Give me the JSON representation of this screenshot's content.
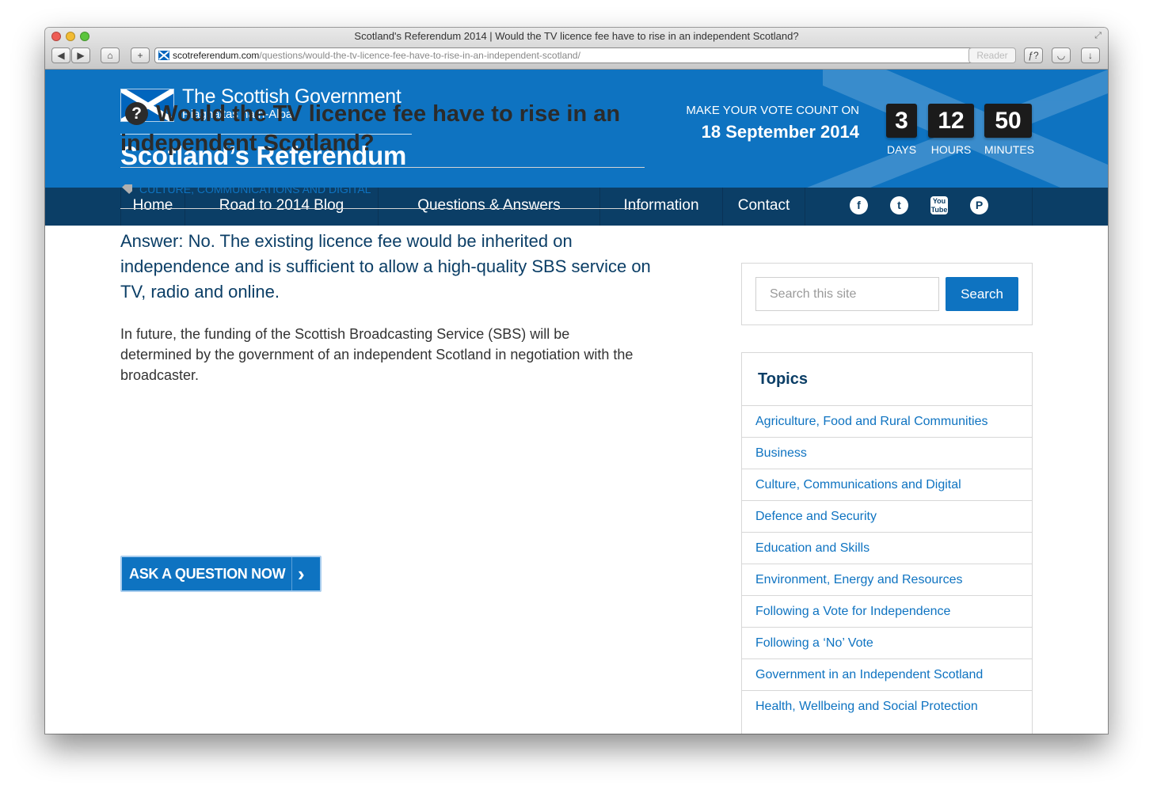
{
  "browser": {
    "window_title": "Scotland's Referendum 2014 | Would the TV licence fee have to rise in an independent Scotland?",
    "url_domain": "scotreferendum.com",
    "url_path": "/questions/would-the-tv-licence-fee-have-to-rise-in-an-independent-scotland/",
    "reader_label": "Reader",
    "back_glyph": "◀",
    "forward_glyph": "▶",
    "home_glyph": "⌂",
    "add_glyph": "+",
    "reload_glyph": "↻",
    "resize_glyph": "⤢",
    "font_glyph": "ƒ?",
    "pocket_glyph": "◡",
    "download_glyph": "↓"
  },
  "header": {
    "gov_name": "The Scottish Government",
    "gov_gaelic": "Riaghaltas na h-Alba",
    "site_title": "Scotland’s Referendum",
    "vote_prompt": "MAKE YOUR VOTE COUNT ON",
    "vote_date": "18 September 2014",
    "countdown": [
      {
        "value": "3",
        "label": "DAYS"
      },
      {
        "value": "12",
        "label": "HOURS"
      },
      {
        "value": "50",
        "label": "MINUTES"
      }
    ]
  },
  "nav": {
    "items": [
      "Home",
      "Road to 2014 Blog",
      "Questions & Answers",
      "Information",
      "Contact"
    ],
    "social": {
      "facebook": "f",
      "twitter": "t",
      "youtube": "You Tube",
      "pinterest": "P"
    }
  },
  "article": {
    "question_mark": "?",
    "title": "Would the TV licence fee have to rise in an independent Scotland?",
    "tag": "CULTURE, COMMUNICATIONS AND DIGITAL",
    "answer": "Answer: No. The existing licence fee would be inherited on independence and is sufficient to allow a high-quality SBS service on TV, radio and online.",
    "body": "In future, the funding of the Scottish Broadcasting Service (SBS) will be determined by the government of an independent Scotland in negotiation with the broadcaster.",
    "ask_button": "ASK A QUESTION NOW",
    "ask_chevron": "›"
  },
  "sidebar": {
    "search_placeholder": "Search this site",
    "search_button": "Search",
    "topics_title": "Topics",
    "topics": [
      "Agriculture, Food and Rural Communities",
      "Business",
      "Culture, Communications and Digital",
      "Defence and Security",
      "Education and Skills",
      "Environment, Energy and Resources",
      "Following a Vote for Independence",
      "Following a ‘No’ Vote",
      "Government in an Independent Scotland",
      "Health, Wellbeing and Social Protection"
    ]
  },
  "colors": {
    "brand_blue": "#0e73c1",
    "nav_navy": "#0b3e66",
    "countdown_bg": "#1b1b1b"
  }
}
